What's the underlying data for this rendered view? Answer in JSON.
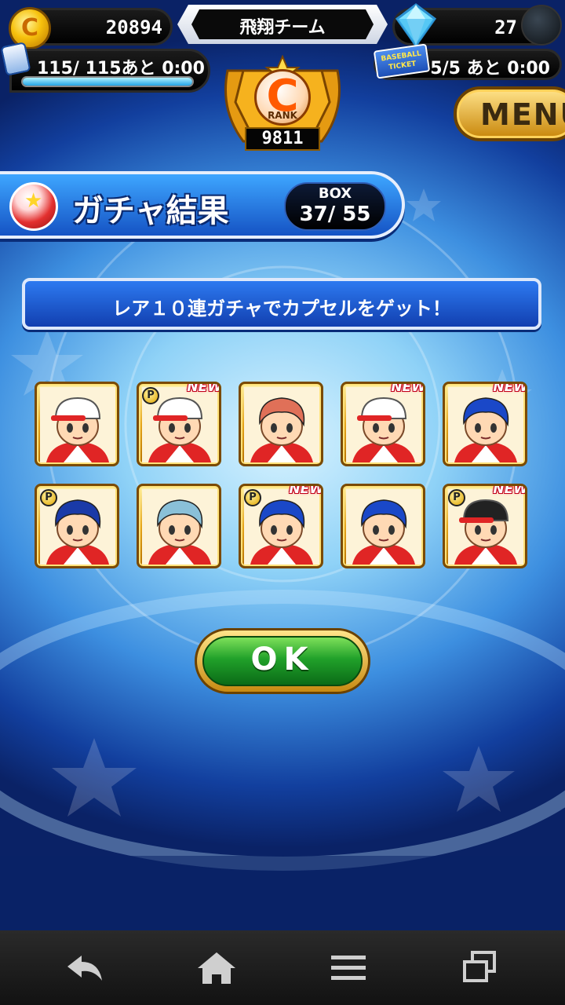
{
  "status": {
    "coins": "20894",
    "team_name": "飛翔チーム",
    "gems": "27",
    "stamina": "115/ 115あと 0:00",
    "stamina_level": 1.0,
    "tickets": "5/5 あと 0:00",
    "ticket_icon_text": "BASEBALL TICKET",
    "rank_letter": "C",
    "rank_label": "RANK",
    "rank_score": "9811"
  },
  "menu_label": "MENU",
  "header": {
    "title": "ガチャ結果",
    "box_label": "BOX",
    "box_count": "37/ 55"
  },
  "message": "レア１０連ガチャでカプセルをゲット！",
  "new_badge": "NEW",
  "p_badge": "P",
  "cards": [
    {
      "id": 1,
      "new": false,
      "p": false,
      "hair": "#2aa0e0",
      "hat": "#ffffff"
    },
    {
      "id": 2,
      "new": true,
      "p": true,
      "hair": "#2a1a14",
      "hat": "#ffffff"
    },
    {
      "id": 3,
      "new": false,
      "p": false,
      "hair": "#e07058",
      "hat": "none"
    },
    {
      "id": 4,
      "new": true,
      "p": false,
      "hair": "#ffe0c0",
      "hat": "#ffffff"
    },
    {
      "id": 5,
      "new": true,
      "p": false,
      "hair": "#1a48c8",
      "hat": "none"
    },
    {
      "id": 6,
      "new": false,
      "p": true,
      "hair": "#1a3aa8",
      "hat": "none"
    },
    {
      "id": 7,
      "new": false,
      "p": false,
      "hair": "#8ac0d8",
      "hat": "none"
    },
    {
      "id": 8,
      "new": true,
      "p": true,
      "hair": "#1a48c8",
      "hat": "none"
    },
    {
      "id": 9,
      "new": false,
      "p": false,
      "hair": "#1a48c8",
      "hat": "none"
    },
    {
      "id": 10,
      "new": true,
      "p": true,
      "hair": "#3a3a3a",
      "hat": "#222222"
    }
  ],
  "ok_label": "OK",
  "nav": [
    "back-icon",
    "home-icon",
    "menu-icon",
    "recent-apps-icon"
  ]
}
